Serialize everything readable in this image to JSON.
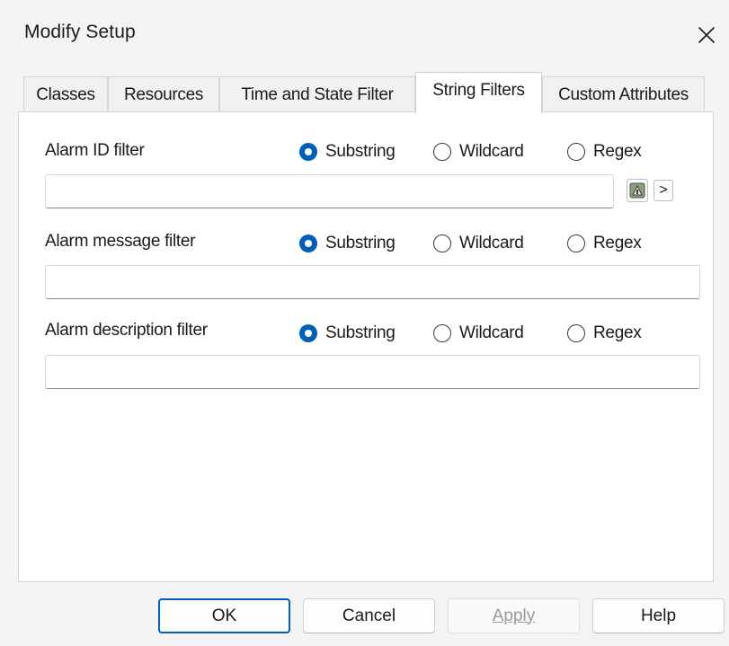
{
  "window": {
    "title": "Modify Setup"
  },
  "tabs": [
    {
      "label": "Classes"
    },
    {
      "label": "Resources"
    },
    {
      "label": "Time and State Filter"
    },
    {
      "label": "String Filters",
      "active": true
    },
    {
      "label": "Custom Attributes"
    }
  ],
  "filters": [
    {
      "label": "Alarm ID filter",
      "mode": "Substring",
      "value": ""
    },
    {
      "label": "Alarm message filter",
      "mode": "Substring",
      "value": ""
    },
    {
      "label": "Alarm description filter",
      "mode": "Substring",
      "value": ""
    }
  ],
  "modes": [
    "Substring",
    "Wildcard",
    "Regex"
  ],
  "id_tools": {
    "expand_label": ">"
  },
  "buttons": {
    "ok": "OK",
    "cancel": "Cancel",
    "apply": "Apply",
    "apply_disabled": true,
    "help": "Help"
  },
  "colors": {
    "accent": "#005fb8"
  },
  "icons": {
    "close": "close-icon",
    "selector": "resource-picker-icon"
  }
}
